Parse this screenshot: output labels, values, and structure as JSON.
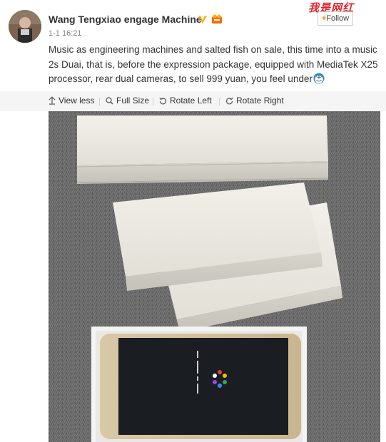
{
  "post": {
    "username": "Wang Tengxiao engage Machine",
    "timestamp": "1-1 16:21",
    "text": "Music as engineering machines and salted fish on sale, this time into a music 2s Duai, that is, before the expression package, equipped with MediaTek X25 processor, rear dual cameras, to sell 999 yuan, you feel under",
    "emoji": "doraemon-emoji",
    "follow_plus": "+",
    "follow_label": "Follow",
    "watermark": "我是网红"
  },
  "icons": {
    "verified": "verified-v-icon",
    "member": "vip-member-icon",
    "view_less": "up-arrow-icon",
    "full_size": "magnifier-icon",
    "rotate_left": "rotate-left-icon",
    "rotate_right": "rotate-right-icon"
  },
  "toolbar": {
    "view_less": "View less",
    "full_size": "Full Size",
    "rotate_left": "Rotate Left",
    "rotate_right": "Rotate Right"
  },
  "colors": {
    "accent_orange": "#ff8200",
    "watermark_red": "#e0242b",
    "toolbar_bg": "#f5f5f5"
  }
}
